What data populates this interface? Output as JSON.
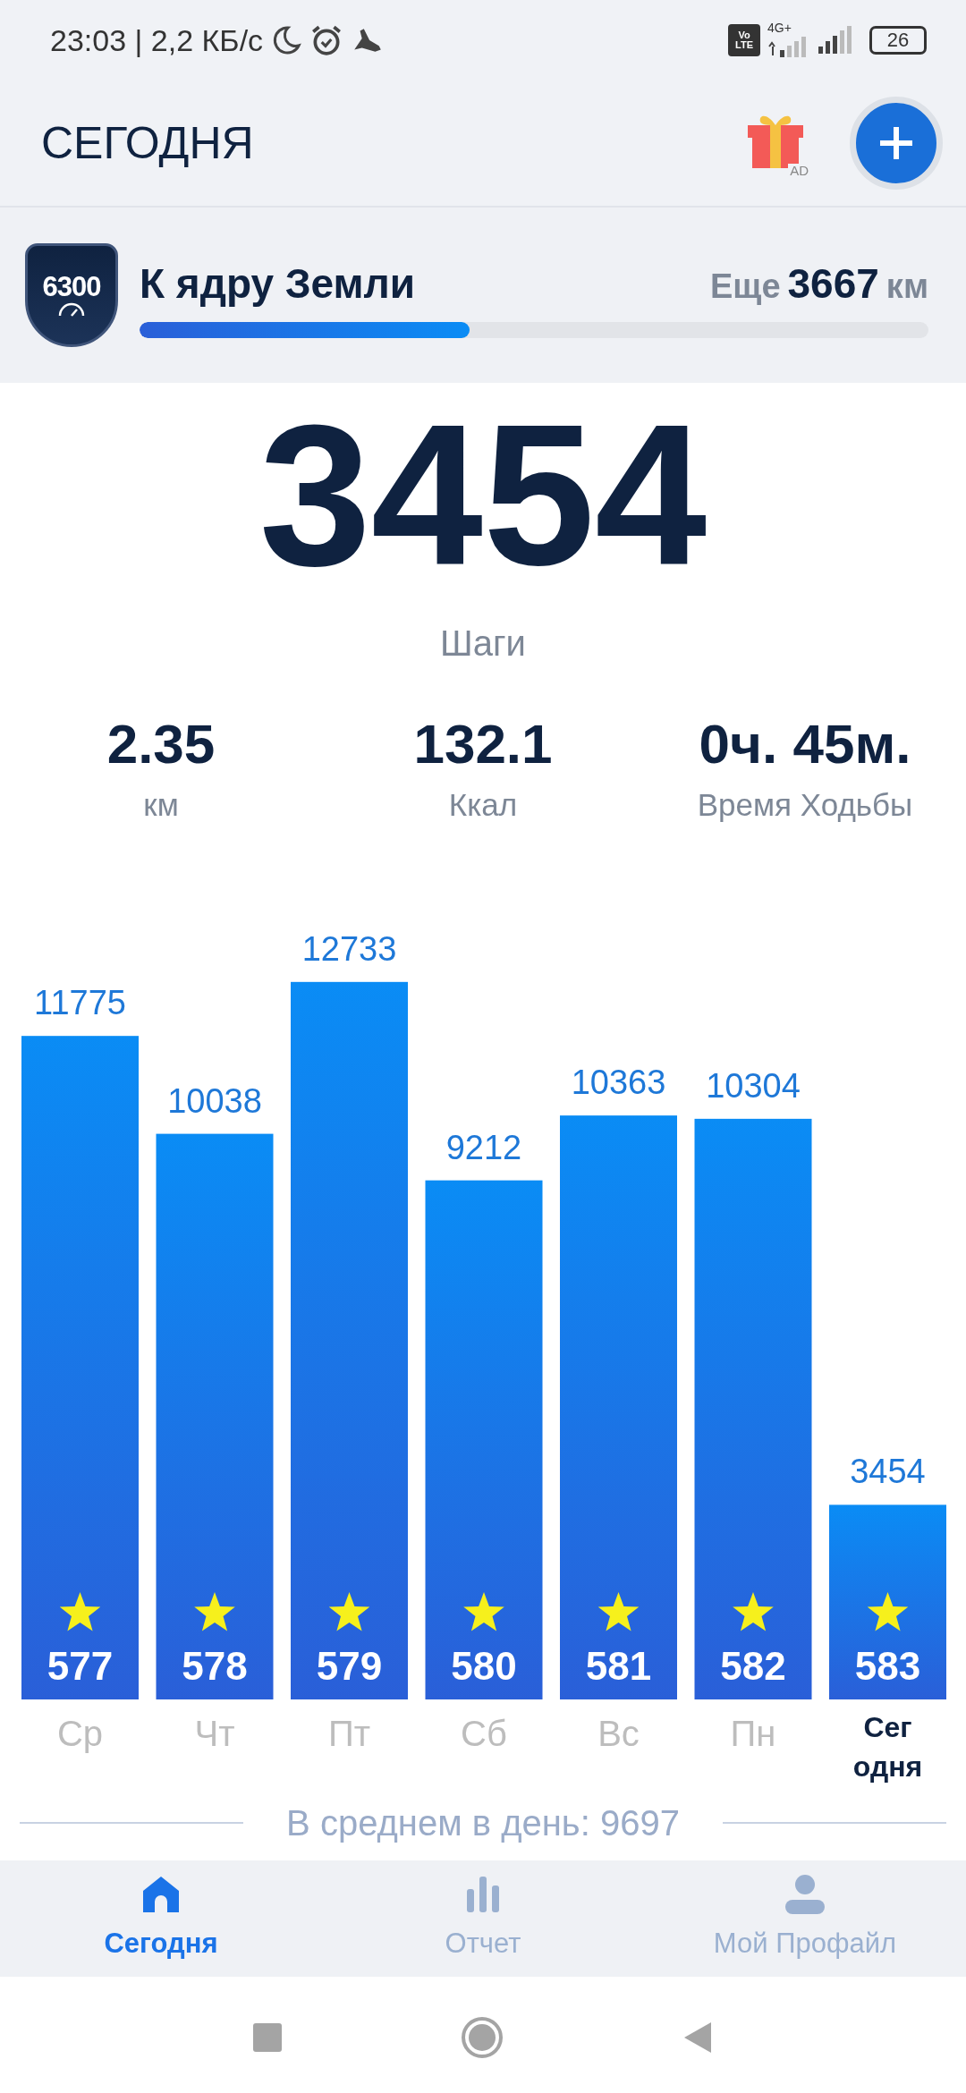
{
  "status_bar": {
    "time": "23:03 | 2,2 КБ/с",
    "network": "4G+",
    "volte_top": "Vo",
    "volte_bottom": "LTE",
    "battery": "26"
  },
  "header": {
    "title": "СЕГОДНЯ",
    "gift_badge": "AD"
  },
  "goal": {
    "badge": "6300",
    "title": "К ядру Земли",
    "remaining_prefix": "Еще",
    "remaining": "3667",
    "unit": "км",
    "level": 0.418
  },
  "today": {
    "steps": "3454",
    "steps_label": "Шаги"
  },
  "stats": [
    {
      "value": "2.35",
      "label": "км"
    },
    {
      "value": "132.1",
      "label": "Ккал"
    },
    {
      "value": "0ч. 45м.",
      "label": "Время Ходьбы"
    }
  ],
  "chart_data": {
    "type": "bar",
    "categories": [
      "Ср",
      "Чт",
      "Пт",
      "Сб",
      "Вс",
      "Пн",
      "Сегодня"
    ],
    "values": [
      11775,
      10038,
      12733,
      9212,
      10363,
      10304,
      3454
    ],
    "value_labels": [
      "11775",
      "10038",
      "12733",
      "9212",
      "10363",
      "10304",
      "3454"
    ]
  },
  "category_states": [
    {
      "selected": false
    },
    {
      "selected": false
    },
    {
      "selected": false
    },
    {
      "selected": false
    },
    {
      "selected": false
    },
    {
      "selected": false
    },
    {
      "selected": true
    }
  ],
  "day_badges": [
    {
      "number": "577",
      "goal_reached": true
    },
    {
      "number": "578",
      "goal_reached": true
    },
    {
      "number": "579",
      "goal_reached": true
    },
    {
      "number": "580",
      "goal_reached": true
    },
    {
      "number": "581",
      "goal_reached": true
    },
    {
      "number": "582",
      "goal_reached": true
    },
    {
      "number": "583",
      "goal_reached": true
    }
  ],
  "average": "В среднем в день: 9697",
  "bottom_nav": [
    {
      "kind": "home",
      "label": "Сегодня",
      "selected": true
    },
    {
      "kind": "report",
      "label": "Отчет",
      "selected": false
    },
    {
      "kind": "profile",
      "label": "Мой Профайл",
      "selected": false
    }
  ]
}
